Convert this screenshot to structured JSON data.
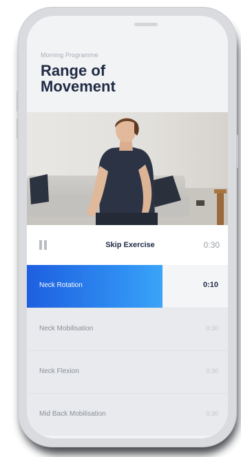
{
  "program": {
    "subtitle": "Morning Programme",
    "title_line1": "Range of",
    "title_line2": "Movement"
  },
  "player": {
    "pause_icon": "pause-icon",
    "skip_label": "Skip Exercise",
    "time": "0:30"
  },
  "exercises": [
    {
      "label": "Neck Rotation",
      "time": "0:10",
      "active": true,
      "progress": 0.67
    },
    {
      "label": "Neck Mobilisation",
      "time": "0:30",
      "active": false
    },
    {
      "label": "Neck Flexion",
      "time": "0:30",
      "active": false
    },
    {
      "label": "Mid Back Mobilisation",
      "time": "0:30",
      "active": false
    }
  ],
  "colors": {
    "title": "#1f2a44",
    "accent_start": "#1d5fe0",
    "accent_end": "#3aa4f8",
    "screen_bg": "#f2f3f5"
  }
}
